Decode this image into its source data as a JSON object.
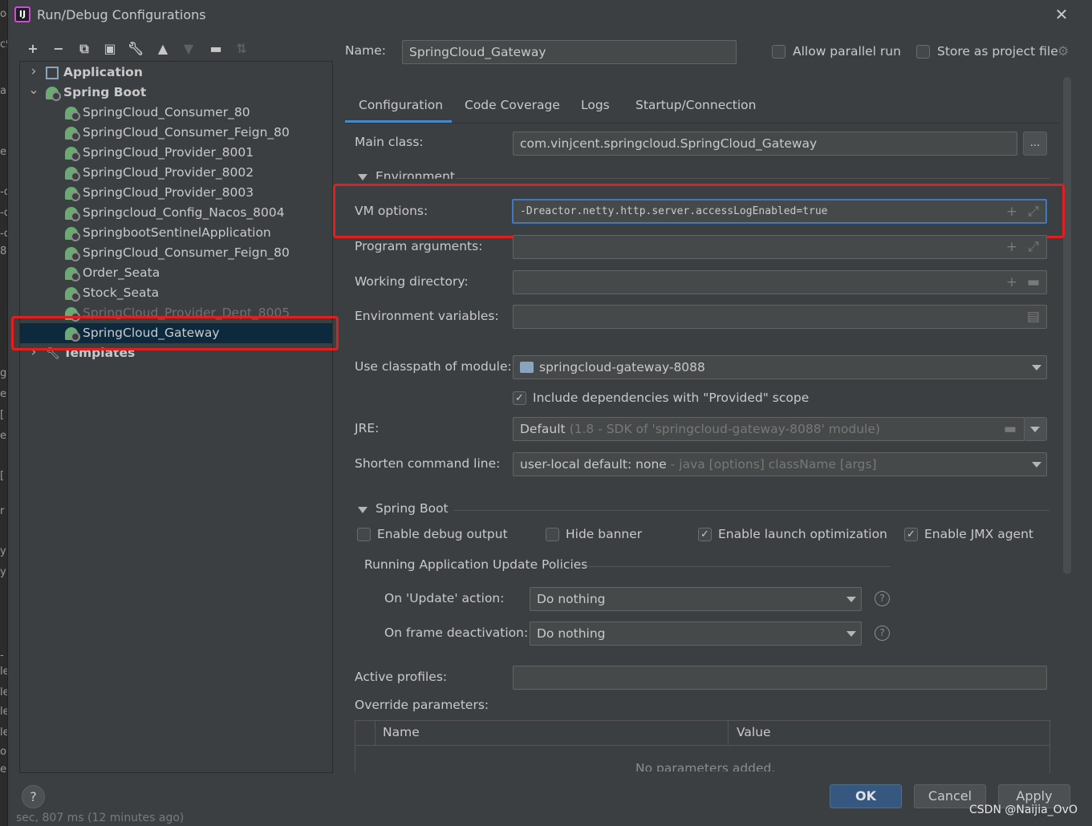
{
  "window": {
    "title": "Run/Debug Configurations"
  },
  "left_strip": [
    "oc",
    "c9",
    "a",
    "el",
    "-c",
    "-c",
    "-c",
    "80",
    "g",
    "e",
    "[",
    "e",
    "[",
    "r",
    "y",
    "y",
    "-",
    "le",
    "le",
    "le",
    "le",
    "o",
    "er"
  ],
  "tree": {
    "items": [
      {
        "label": "Application",
        "level": 0,
        "expanded": false,
        "bold": true,
        "icon": "application-icon"
      },
      {
        "label": "Spring Boot",
        "level": 0,
        "expanded": true,
        "bold": true,
        "icon": "spring-boot-icon"
      },
      {
        "label": "SpringCloud_Consumer_80",
        "level": 1,
        "icon": "spring-boot-icon"
      },
      {
        "label": "SpringCloud_Consumer_Feign_80",
        "level": 1,
        "icon": "spring-boot-icon"
      },
      {
        "label": "SpringCloud_Provider_8001",
        "level": 1,
        "icon": "spring-boot-icon"
      },
      {
        "label": "SpringCloud_Provider_8002",
        "level": 1,
        "icon": "spring-boot-icon"
      },
      {
        "label": "SpringCloud_Provider_8003",
        "level": 1,
        "icon": "spring-boot-icon"
      },
      {
        "label": "Springcloud_Config_Nacos_8004",
        "level": 1,
        "icon": "spring-boot-icon"
      },
      {
        "label": "SpringbootSentinelApplication",
        "level": 1,
        "icon": "spring-boot-icon"
      },
      {
        "label": "SpringCloud_Consumer_Feign_80",
        "level": 1,
        "icon": "spring-boot-icon"
      },
      {
        "label": "Order_Seata",
        "level": 1,
        "icon": "spring-boot-icon"
      },
      {
        "label": "Stock_Seata",
        "level": 1,
        "icon": "spring-boot-icon"
      },
      {
        "label": "SpringCloud_Provider_Dept_8005",
        "level": 1,
        "icon": "spring-boot-icon",
        "faded": true
      },
      {
        "label": "SpringCloud_Gateway",
        "level": 1,
        "icon": "spring-boot-icon",
        "selected": true
      },
      {
        "label": "Templates",
        "level": 0,
        "expanded": false,
        "bold": true,
        "icon": "wrench-icon"
      }
    ]
  },
  "header": {
    "name_label": "Name:",
    "name_value": "SpringCloud_Gateway",
    "allow_parallel_label": "Allow parallel run",
    "allow_parallel_checked": false,
    "store_as_project_label": "Store as project file",
    "store_as_project_checked": false
  },
  "tabs": [
    {
      "label": "Configuration",
      "active": true
    },
    {
      "label": "Code Coverage"
    },
    {
      "label": "Logs"
    },
    {
      "label": "Startup/Connection"
    }
  ],
  "config": {
    "main_class_label": "Main class:",
    "main_class_value": "com.vinjcent.springcloud.SpringCloud_Gateway",
    "browse_label": "...",
    "environment_section": "Environment",
    "vm_options_label": "VM options:",
    "vm_options_value": "-Dreactor.netty.http.server.accessLogEnabled=true",
    "program_args_label": "Program arguments:",
    "program_args_value": "",
    "working_dir_label": "Working directory:",
    "working_dir_value": "",
    "env_vars_label": "Environment variables:",
    "env_vars_value": "",
    "classpath_label": "Use classpath of module:",
    "classpath_value": "springcloud-gateway-8088",
    "include_deps_label": "Include dependencies with \"Provided\" scope",
    "include_deps_checked": true,
    "jre_label": "JRE:",
    "jre_value": "Default",
    "jre_hint": "(1.8 - SDK of 'springcloud-gateway-8088' module)",
    "shorten_label": "Shorten command line:",
    "shorten_value": "user-local default: none",
    "shorten_hint": "- java [options] className [args]"
  },
  "spring_boot": {
    "section": "Spring Boot",
    "debug_output_label": "Enable debug output",
    "debug_output_checked": false,
    "hide_banner_label": "Hide banner",
    "hide_banner_checked": false,
    "launch_opt_label": "Enable launch optimization",
    "launch_opt_checked": true,
    "jmx_label": "Enable JMX agent",
    "jmx_checked": true,
    "update_policies_section": "Running Application Update Policies",
    "on_update_label": "On 'Update' action:",
    "on_update_value": "Do nothing",
    "on_frame_label": "On frame deactivation:",
    "on_frame_value": "Do nothing",
    "active_profiles_label": "Active profiles:",
    "active_profiles_value": "",
    "override_label": "Override parameters:",
    "table_columns": [
      "Name",
      "Value"
    ],
    "table_empty": "No parameters added."
  },
  "footer": {
    "help_label": "?",
    "ok_label": "OK",
    "cancel_label": "Cancel",
    "apply_label": "Apply",
    "bleed_text": "sec, 807 ms (12 minutes ago)"
  },
  "watermark": "CSDN @Naijia_OvO",
  "colors": {
    "accent": "#3d7ac2",
    "selection": "#0d293e",
    "highlight_box": "#e01f1f",
    "primary_button": "#365880",
    "background": "#3c3f41"
  }
}
